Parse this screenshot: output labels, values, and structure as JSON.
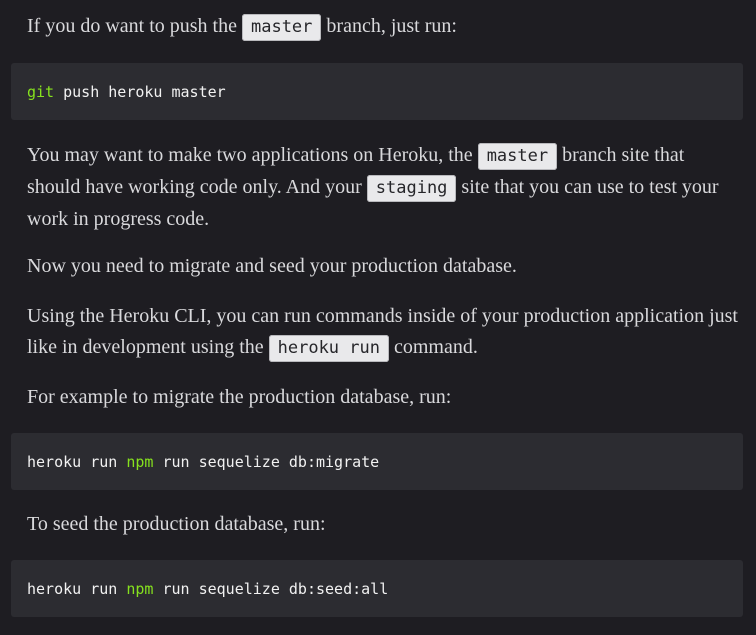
{
  "para1": {
    "before": "If you do want to push the ",
    "code": "master",
    "after": " branch, just run:"
  },
  "code1": {
    "keyword": "git",
    "rest": " push heroku master"
  },
  "para2": {
    "t1": "You may want to make two applications on Heroku, the ",
    "code1": "master",
    "t2": " branch site that should have working code only. And your ",
    "code2": "staging",
    "t3": " site that you can use to test your work in progress code."
  },
  "para3": {
    "text": "Now you need to migrate and seed your production database."
  },
  "para4": {
    "before": "Using the Heroku CLI, you can run commands inside of your production application just like in development using the ",
    "code": "heroku run",
    "after": " command."
  },
  "para5": {
    "text": "For example to migrate the production database, run:"
  },
  "code2": {
    "pre": "heroku run ",
    "keyword": "npm",
    "rest": " run sequelize db:migrate"
  },
  "para6": {
    "text": "To seed the production database, run:"
  },
  "code3": {
    "pre": "heroku run ",
    "keyword": "npm",
    "rest": " run sequelize db:seed:all"
  },
  "colors": {
    "background": "#1e1d22",
    "code_block": "#2c2c31",
    "highlight": "#86e21e",
    "inline_code_bg": "#e9e9eb"
  }
}
